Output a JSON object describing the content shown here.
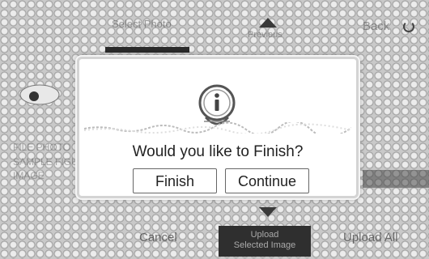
{
  "background": {
    "tab_select_photo": "Select Photo",
    "tab_previous": "Previous",
    "back_label": "Back",
    "left_labels": [
      "FILE PHOTO",
      "SAMPLE FIGURE",
      "IMAGE"
    ],
    "bottom": {
      "cancel_label": "Cancel",
      "upload_selected_line1": "Upload",
      "upload_selected_line2": "Selected Image",
      "upload_all_label": "Upload All"
    }
  },
  "dialog": {
    "icon": "info-icon",
    "question": "Would you like to Finish?",
    "finish_label": "Finish",
    "continue_label": "Continue"
  },
  "colors": {
    "dialog_bg": "#ffffff",
    "dialog_border": "#d4d4d4",
    "upload_button_bg": "#2f2f2f"
  }
}
